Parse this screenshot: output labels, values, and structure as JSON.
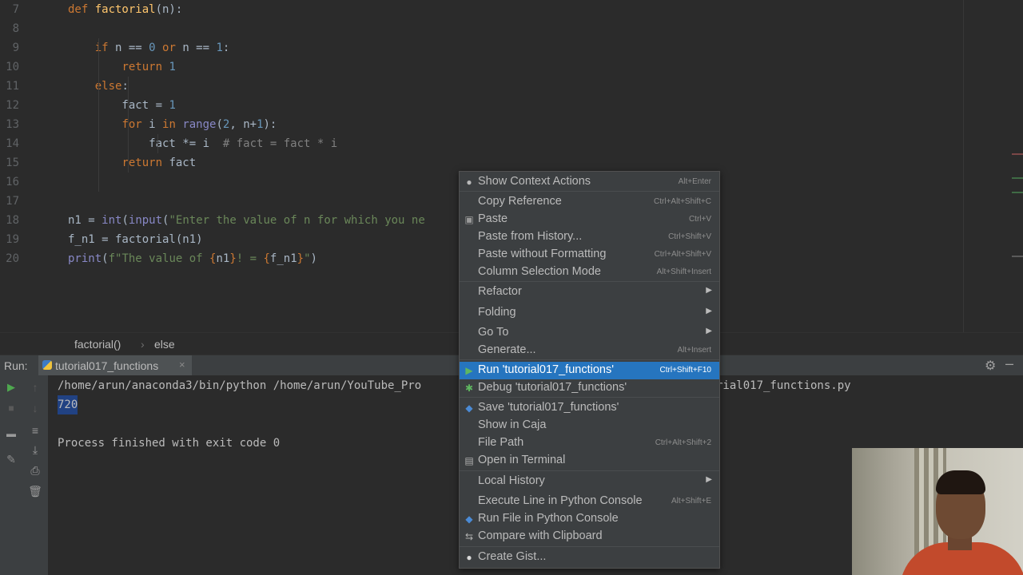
{
  "editor": {
    "line_numbers": [
      "7",
      "8",
      "9",
      "10",
      "11",
      "12",
      "13",
      "14",
      "15",
      "16",
      "17",
      "18",
      "19",
      "20"
    ],
    "code_lines": [
      {
        "no": "7",
        "tokens": [
          {
            "c": "kw",
            "t": "def "
          },
          {
            "c": "fn",
            "t": "factorial"
          },
          {
            "c": "",
            "t": "(n):"
          }
        ]
      },
      {
        "no": "8",
        "tokens": []
      },
      {
        "no": "9",
        "tokens": [
          {
            "c": "",
            "t": "    "
          },
          {
            "c": "kw",
            "t": "if "
          },
          {
            "c": "",
            "t": "n == "
          },
          {
            "c": "num",
            "t": "0"
          },
          {
            "c": "kw",
            "t": " or "
          },
          {
            "c": "",
            "t": "n == "
          },
          {
            "c": "num",
            "t": "1"
          },
          {
            "c": "",
            "t": ":"
          }
        ]
      },
      {
        "no": "10",
        "tokens": [
          {
            "c": "",
            "t": "        "
          },
          {
            "c": "kw",
            "t": "return "
          },
          {
            "c": "num",
            "t": "1"
          }
        ]
      },
      {
        "no": "11",
        "tokens": [
          {
            "c": "",
            "t": "    "
          },
          {
            "c": "kw",
            "t": "else"
          },
          {
            "c": "",
            "t": ":"
          }
        ]
      },
      {
        "no": "12",
        "tokens": [
          {
            "c": "",
            "t": "        fact = "
          },
          {
            "c": "num",
            "t": "1"
          }
        ]
      },
      {
        "no": "13",
        "tokens": [
          {
            "c": "",
            "t": "        "
          },
          {
            "c": "kw",
            "t": "for "
          },
          {
            "c": "",
            "t": "i "
          },
          {
            "c": "kw",
            "t": "in "
          },
          {
            "c": "bi",
            "t": "range"
          },
          {
            "c": "",
            "t": "("
          },
          {
            "c": "num",
            "t": "2"
          },
          {
            "c": "",
            "t": ", n+"
          },
          {
            "c": "num",
            "t": "1"
          },
          {
            "c": "",
            "t": "):"
          }
        ]
      },
      {
        "no": "14",
        "tokens": [
          {
            "c": "",
            "t": "            fact *= i  "
          },
          {
            "c": "cmt",
            "t": "# fact = fact * i"
          }
        ]
      },
      {
        "no": "15",
        "tokens": [
          {
            "c": "",
            "t": "        "
          },
          {
            "c": "kw",
            "t": "return "
          },
          {
            "c": "",
            "t": "fact"
          }
        ]
      },
      {
        "no": "16",
        "tokens": []
      },
      {
        "no": "17",
        "tokens": []
      },
      {
        "no": "18",
        "tokens": [
          {
            "c": "",
            "t": "n1 = "
          },
          {
            "c": "bi",
            "t": "int"
          },
          {
            "c": "",
            "t": "("
          },
          {
            "c": "bi",
            "t": "input"
          },
          {
            "c": "",
            "t": "("
          },
          {
            "c": "str",
            "t": "\"Enter the value of n for which you ne"
          }
        ]
      },
      {
        "no": "19",
        "tokens": [
          {
            "c": "",
            "t": "f_n1 = factorial(n1)"
          }
        ]
      },
      {
        "no": "20",
        "tokens": [
          {
            "c": "bi",
            "t": "print"
          },
          {
            "c": "",
            "t": "("
          },
          {
            "c": "str",
            "t": "f\"The value of "
          },
          {
            "c": "kw",
            "t": "{"
          },
          {
            "c": "",
            "t": "n1"
          },
          {
            "c": "kw",
            "t": "}"
          },
          {
            "c": "str",
            "t": "! = "
          },
          {
            "c": "kw",
            "t": "{"
          },
          {
            "c": "",
            "t": "f_n1"
          },
          {
            "c": "kw",
            "t": "}"
          },
          {
            "c": "str",
            "t": "\""
          },
          {
            "c": "",
            "t": ")"
          }
        ]
      }
    ],
    "current_line": "15"
  },
  "breadcrumb": {
    "function": "factorial()",
    "separator": "›",
    "block": "else"
  },
  "run_panel": {
    "label": "Run:",
    "tab_label": "tutorial017_functions",
    "close_glyph": "×",
    "output_line1": "/home/arun/anaconda3/bin/python /home/arun/YouTube_Pro",
    "output_line1_tail": "rial017_functions.py",
    "output_line2": "720",
    "output_line3": "Process finished with exit code 0"
  },
  "context_menu": {
    "items": [
      {
        "label": "Show Context Actions",
        "shortcut": "Alt+Enter",
        "icon": "bulb-icon"
      },
      {
        "label": "Copy Reference",
        "shortcut": "Ctrl+Alt+Shift+C"
      },
      {
        "label": "Paste",
        "shortcut": "Ctrl+V",
        "icon": "clipboard-icon"
      },
      {
        "label": "Paste from History...",
        "shortcut": "Ctrl+Shift+V"
      },
      {
        "label": "Paste without Formatting",
        "shortcut": "Ctrl+Alt+Shift+V"
      },
      {
        "label": "Column Selection Mode",
        "shortcut": "Alt+Shift+Insert"
      },
      {
        "label": "Refactor",
        "submenu": true
      },
      {
        "label": "Folding",
        "submenu": true
      },
      {
        "label": "Go To",
        "submenu": true
      },
      {
        "label": "Generate...",
        "shortcut": "Alt+Insert"
      },
      {
        "label": "Run 'tutorial017_functions'",
        "shortcut": "Ctrl+Shift+F10",
        "icon": "run-icon",
        "selected": true
      },
      {
        "label": "Debug 'tutorial017_functions'",
        "icon": "debug-icon"
      },
      {
        "label": "Save 'tutorial017_functions'",
        "icon": "python-icon"
      },
      {
        "label": "Show in Caja"
      },
      {
        "label": "File Path",
        "shortcut": "Ctrl+Alt+Shift+2"
      },
      {
        "label": "Open in Terminal",
        "icon": "terminal-icon"
      },
      {
        "label": "Local History",
        "submenu": true
      },
      {
        "label": "Execute Line in Python Console",
        "shortcut": "Alt+Shift+E"
      },
      {
        "label": "Run File in Python Console",
        "icon": "python-icon"
      },
      {
        "label": "Compare with Clipboard",
        "icon": "compare-icon"
      },
      {
        "label": "Create Gist...",
        "icon": "github-icon"
      }
    ],
    "submenu_arrow": "▶"
  },
  "colors": {
    "editor_bg": "#2b2b2b",
    "panel_bg": "#3c3f41",
    "selection": "#2675bf",
    "keyword": "#cc7832",
    "number": "#6897bb",
    "string": "#6a8759"
  }
}
